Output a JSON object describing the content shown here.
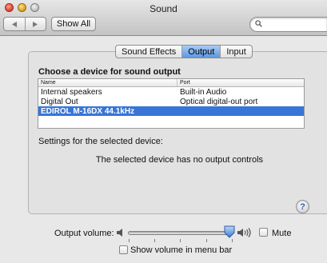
{
  "window": {
    "title": "Sound"
  },
  "toolbar": {
    "back_icon": "chevron-left-icon",
    "forward_icon": "chevron-right-icon",
    "show_all_label": "Show All",
    "search_value": "",
    "search_icon": "search-icon"
  },
  "tabs": [
    {
      "label": "Sound Effects",
      "active": false
    },
    {
      "label": "Output",
      "active": true
    },
    {
      "label": "Input",
      "active": false
    }
  ],
  "output": {
    "heading": "Choose a device for sound output",
    "columns": [
      "Name",
      "Port"
    ],
    "devices": [
      {
        "name": "Internal speakers",
        "port": "Built-in Audio",
        "selected": false
      },
      {
        "name": "Digital Out",
        "port": "Optical digital-out port",
        "selected": false
      },
      {
        "name": "EDIROL M-16DX 44.1kHz",
        "port": "",
        "selected": true
      }
    ],
    "settings_label": "Settings for the selected device:",
    "no_controls_text": "The selected device has no output controls",
    "help_label": "?"
  },
  "volume": {
    "label": "Output volume:",
    "level": 0.96,
    "mute_label": "Mute",
    "mute_checked": false,
    "show_in_menu_bar_label": "Show volume in menu bar",
    "show_in_menu_bar_checked": false
  },
  "colors": {
    "selection": "#3875d7",
    "tab_active": "#6aa3e8",
    "slider_thumb": "#4f88d8"
  }
}
